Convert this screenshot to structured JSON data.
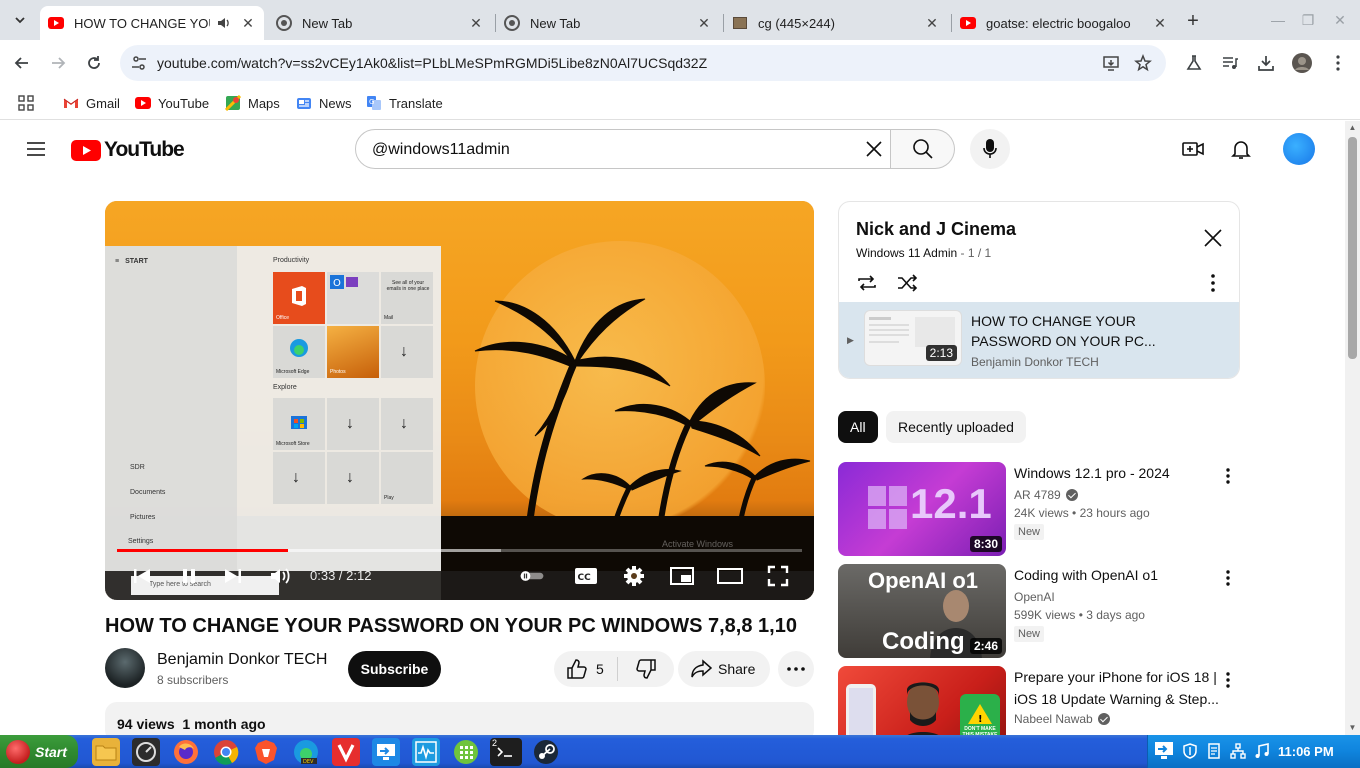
{
  "browser": {
    "tabs": [
      {
        "title": "HOW TO CHANGE YOU",
        "favicon": "youtube-icon",
        "active": true
      },
      {
        "title": "New Tab",
        "favicon": "chrome-icon"
      },
      {
        "title": "New Tab",
        "favicon": "chrome-icon"
      },
      {
        "title": "cg (445×244)",
        "favicon": "image-icon"
      },
      {
        "title": "goatse: electric boogaloo",
        "favicon": "youtube-icon"
      }
    ],
    "url": "youtube.com/watch?v=ss2vCEy1Ak0&list=PLbLMeSPmRGMDi5Libe8zN0Al7UCSqd32Z",
    "bookmarks": [
      "Gmail",
      "YouTube",
      "Maps",
      "News",
      "Translate"
    ]
  },
  "youtube": {
    "logo_text": "YouTube",
    "search_value": "@windows11admin",
    "player": {
      "time": "0:33 / 2:12",
      "progress_fraction": 0.25,
      "buffer_fraction": 0.56,
      "watermark": "Activate Windows",
      "start_label": "START",
      "productivity_label": "Productivity",
      "explore_label": "Explore",
      "tiles": [
        "Office",
        "Microsoft Edge",
        "Photos",
        "Microsoft Store",
        "Mail",
        "Play"
      ],
      "left_items": [
        "SDR",
        "Documents",
        "Pictures",
        "Settings"
      ],
      "mail_tile_text": "See all of your emails in one place",
      "taskbar_search": "Type here to search"
    },
    "video_title": "HOW TO CHANGE YOUR PASSWORD ON YOUR PC WINDOWS 7,8,8 1,10",
    "channel": {
      "name": "Benjamin Donkor TECH",
      "subscribers": "8 subscribers"
    },
    "subscribe_label": "Subscribe",
    "likes": "5",
    "share_label": "Share",
    "views": "94 views",
    "upload_age": "1 month ago",
    "playlist": {
      "title": "Nick and J Cinema",
      "owner": "Windows 11 Admin",
      "position": "1 / 1",
      "separator": " - ",
      "item": {
        "title": "HOW TO CHANGE YOUR PASSWORD ON YOUR PC...",
        "channel": "Benjamin Donkor TECH",
        "duration": "2:13"
      }
    },
    "chips": [
      "All",
      "Recently uploaded"
    ],
    "recommendations": [
      {
        "title": "Windows 12.1 pro - 2024",
        "channel": "AR 4789",
        "verified": true,
        "views": "24K views",
        "age": "23 hours ago",
        "badge": "New",
        "duration": "8:30",
        "thumb_text": "12.1"
      },
      {
        "title": "Coding with OpenAI o1",
        "channel": "OpenAI",
        "verified": false,
        "views": "599K views",
        "age": "3 days ago",
        "badge": "New",
        "duration": "2:46",
        "thumb_text_top": "OpenAI o1",
        "thumb_text_bottom": "Coding"
      },
      {
        "title": "Prepare your iPhone for iOS 18 | iOS 18 Update Warning & Step...",
        "channel": "Nabeel Nawab",
        "verified": true,
        "views": "",
        "age": "",
        "badge": "",
        "duration": "",
        "thumb_text": "DON'T MAKE THIS MISTAKE"
      }
    ]
  },
  "taskbar": {
    "start_label": "Start",
    "clock": "11:06 PM",
    "terminal_badge": "2"
  },
  "colors": {
    "youtube_red": "#ff0000",
    "taskbar_blue": "#245edb",
    "start_green": "#2f8a2f",
    "tray_blue": "#0f84dd"
  }
}
